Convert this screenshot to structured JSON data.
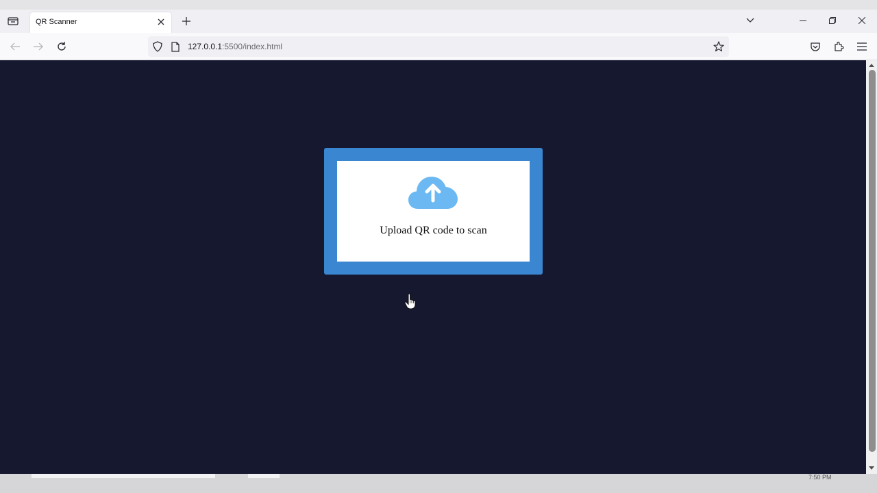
{
  "browser": {
    "tab": {
      "title": "QR Scanner"
    },
    "address": {
      "host": "127.0.0.1",
      "path": ":5500/index.html"
    }
  },
  "page": {
    "upload_label": "Upload QR code to scan",
    "colors": {
      "background": "#161830",
      "card_border": "#3b86d1",
      "cloud": "#6cb8f2"
    }
  },
  "taskbar": {
    "clock_fragment": "7:50 PM"
  }
}
